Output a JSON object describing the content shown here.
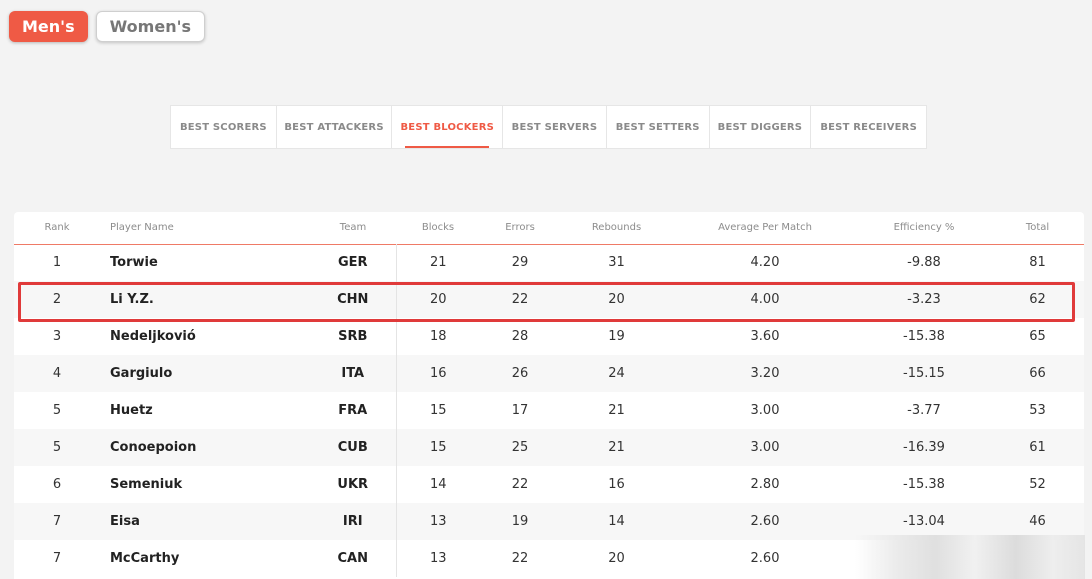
{
  "gender": {
    "men_label": "Men's",
    "women_label": "Women's",
    "selected": "Men's"
  },
  "tabs": [
    {
      "label": "BEST SCORERS",
      "active": false
    },
    {
      "label": "BEST ATTACKERS",
      "active": false
    },
    {
      "label": "BEST BLOCKERS",
      "active": true
    },
    {
      "label": "BEST SERVERS",
      "active": false
    },
    {
      "label": "BEST SETTERS",
      "active": false
    },
    {
      "label": "BEST DIGGERS",
      "active": false
    },
    {
      "label": "BEST RECEIVERS",
      "active": false
    }
  ],
  "table": {
    "headers": [
      "Rank",
      "Player Name",
      "Team",
      "Blocks",
      "Errors",
      "Rebounds",
      "Average Per Match",
      "Efficiency %",
      "Total"
    ],
    "rows": [
      [
        "1",
        "Torwie",
        "GER",
        "21",
        "29",
        "31",
        "4.20",
        "-9.88",
        "81"
      ],
      [
        "2",
        "Li Y.Z.",
        "CHN",
        "20",
        "22",
        "20",
        "4.00",
        "-3.23",
        "62"
      ],
      [
        "3",
        "Nedeljkovió",
        "SRB",
        "18",
        "28",
        "19",
        "3.60",
        "-15.38",
        "65"
      ],
      [
        "4",
        "Gargiulo",
        "ITA",
        "16",
        "26",
        "24",
        "3.20",
        "-15.15",
        "66"
      ],
      [
        "5",
        "Huetz",
        "FRA",
        "15",
        "17",
        "21",
        "3.00",
        "-3.77",
        "53"
      ],
      [
        "5",
        "Conoepoion",
        "CUB",
        "15",
        "25",
        "21",
        "3.00",
        "-16.39",
        "61"
      ],
      [
        "6",
        "Semeniuk",
        "UKR",
        "14",
        "22",
        "16",
        "2.80",
        "-15.38",
        "52"
      ],
      [
        "7",
        "Eisa",
        "IRI",
        "13",
        "19",
        "14",
        "2.60",
        "-13.04",
        "46"
      ],
      [
        "7",
        "McCarthy",
        "CAN",
        "13",
        "22",
        "20",
        "2.60",
        "",
        ""
      ]
    ]
  },
  "colors": {
    "accent": "#ef5a45",
    "highlight": "#e03a3a"
  }
}
